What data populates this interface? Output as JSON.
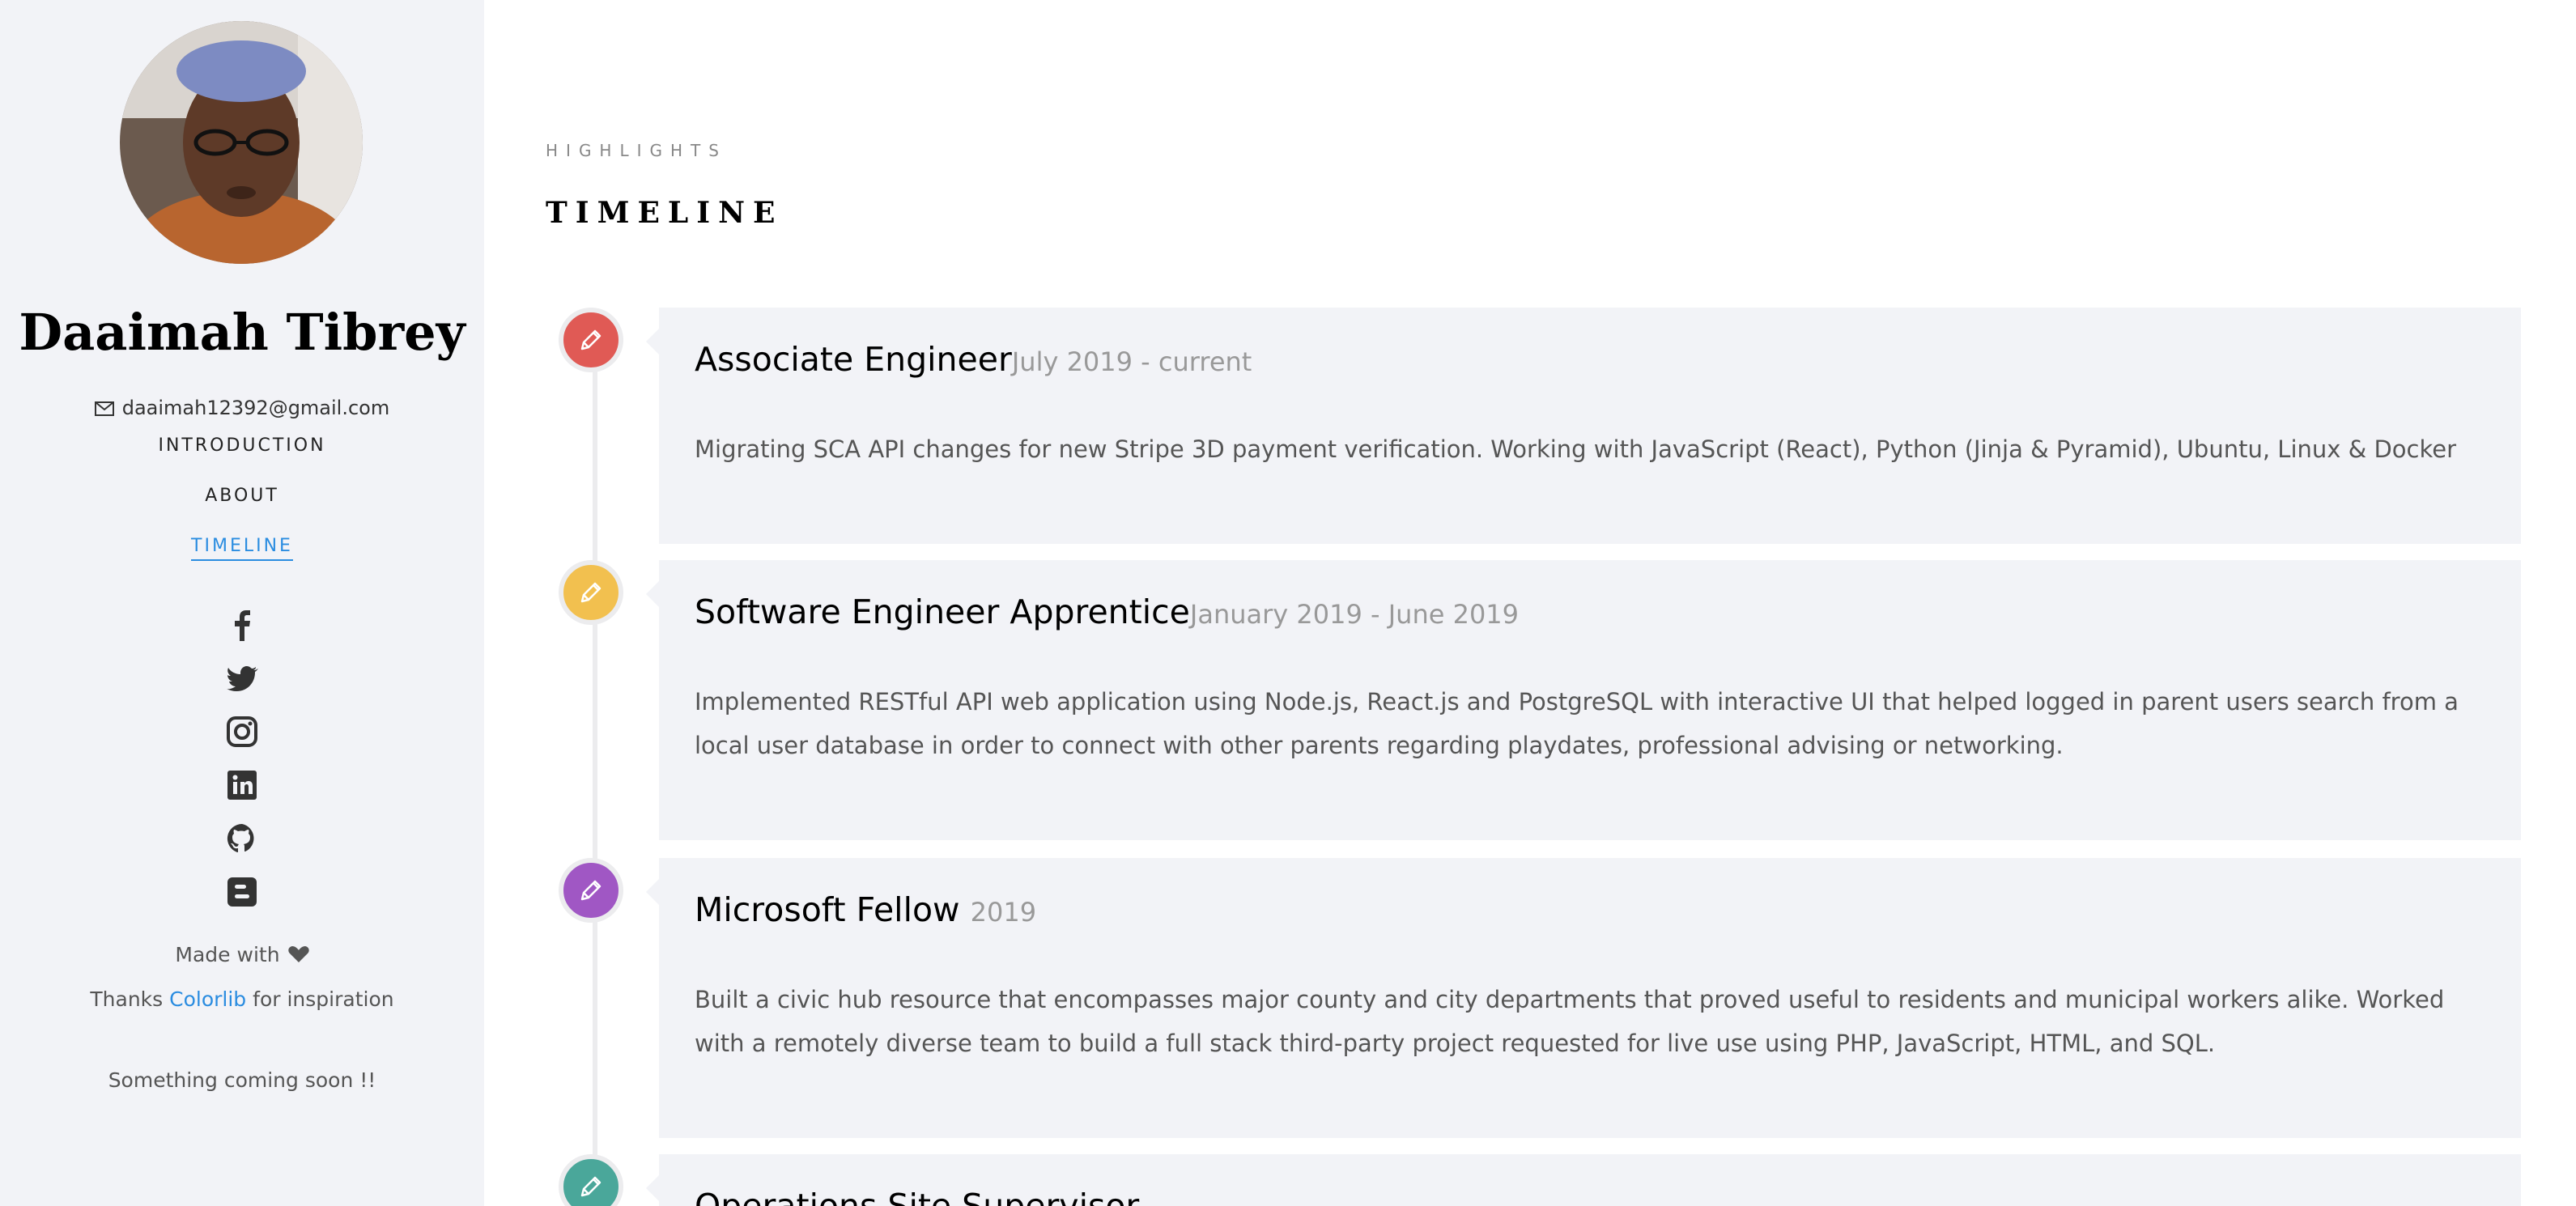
{
  "sidebar": {
    "name": "Daaimah Tibrey",
    "email": "daaimah12392@gmail.com",
    "nav": [
      {
        "label": "INTRODUCTION"
      },
      {
        "label": "ABOUT"
      },
      {
        "label": "TIMELINE",
        "active": true
      }
    ],
    "social": [
      "facebook-icon",
      "twitter-icon",
      "instagram-icon",
      "linkedin-icon",
      "github-icon",
      "blogger-icon"
    ],
    "made_with": "Made with",
    "thanks_prefix": "Thanks",
    "thanks_link": "Colorlib",
    "thanks_suffix": "for inspiration",
    "coming_soon": "Something coming soon !!"
  },
  "main": {
    "eyebrow": "HIGHLIGHTS",
    "title": "TIMELINE",
    "entries": [
      {
        "title": "Associate Engineer",
        "date": "July 2019 - current",
        "description": "Migrating SCA API changes for new Stripe 3D payment verification. Working with JavaScript (React), Python (Jinja & Pyramid), Ubuntu, Linux & Docker",
        "color": "#e05a55"
      },
      {
        "title": "Software Engineer Apprentice",
        "date": "January 2019 - June 2019",
        "description": "Implemented RESTful API web application using Node.js, React.js and PostgreSQL with interactive UI that helped logged in parent users search from a local user database in order to connect with other parents regarding playdates, professional advising or networking.",
        "color": "#f2c04f"
      },
      {
        "title": "Microsoft Fellow",
        "date": "2019",
        "description": "Built a civic hub resource that encompasses major county and city departments that proved useful to residents and municipal workers alike. Worked with a remotely diverse team to build a full stack third-party project requested for live use using PHP, JavaScript, HTML, and SQL.",
        "color": "#a057c4"
      },
      {
        "title": "Operations Site Supervisor",
        "date": "",
        "description": "",
        "color": "#4aa79a"
      }
    ]
  },
  "colors": {
    "accent": "#2a8ce0",
    "sidebar_bg": "#f2f3f7",
    "card_bg": "#f2f3f7"
  }
}
